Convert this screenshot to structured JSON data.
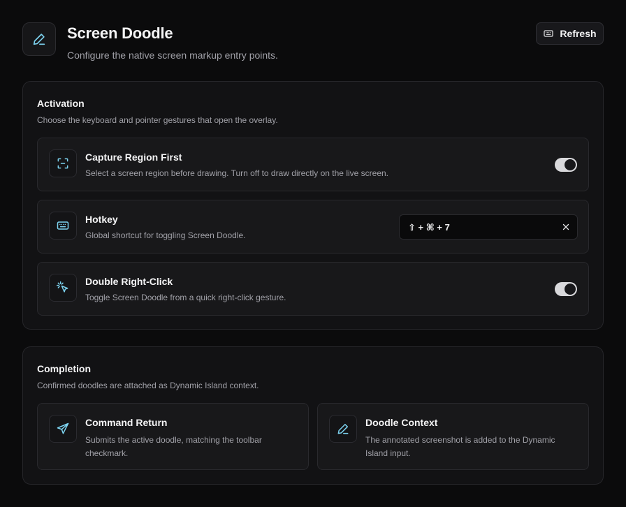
{
  "header": {
    "title": "Screen Doodle",
    "subtitle": "Configure the native screen markup entry points.",
    "refresh_label": "Refresh",
    "app_icon": "pencil-icon",
    "refresh_icon": "keyboard-icon"
  },
  "activation": {
    "title": "Activation",
    "description": "Choose the keyboard and pointer gestures that open the overlay.",
    "rows": [
      {
        "title": "Capture Region First",
        "description": "Select a screen region before drawing. Turn off to draw directly on the live screen.",
        "icon": "region-capture-icon",
        "enabled": true
      },
      {
        "title": "Hotkey",
        "description": "Global shortcut for toggling Screen Doodle.",
        "icon": "keyboard-icon",
        "value": "⇧ + ⌘ + 7"
      },
      {
        "title": "Double Right-Click",
        "description": "Toggle Screen Doodle from a quick right-click gesture.",
        "icon": "pointer-click-icon",
        "enabled": true
      }
    ]
  },
  "completion": {
    "title": "Completion",
    "description": "Confirmed doodles are attached as Dynamic Island context.",
    "tiles": [
      {
        "title": "Command Return",
        "description": "Submits the active doodle, matching the toolbar checkmark.",
        "icon": "send-icon"
      },
      {
        "title": "Doodle Context",
        "description": "The annotated screenshot is added to the Dynamic Island input.",
        "icon": "pencil-icon"
      }
    ]
  },
  "colors": {
    "accent": "#7dd3f0",
    "background": "#0b0b0c",
    "card": "#121214",
    "toggle_on": "#d9d9dc"
  }
}
